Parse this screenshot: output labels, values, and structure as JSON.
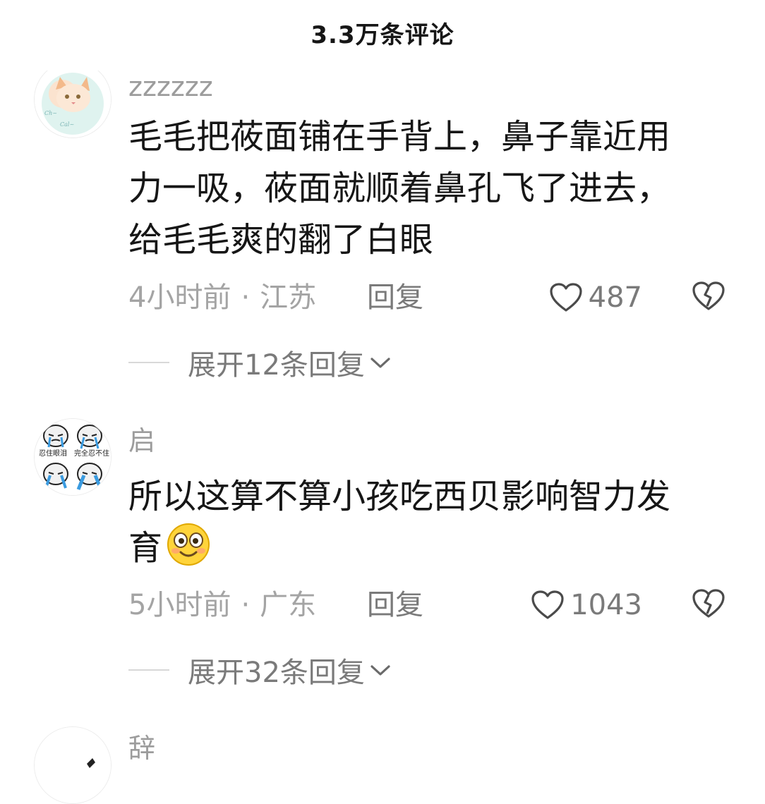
{
  "header": {
    "title": "3.3万条评论"
  },
  "comments": [
    {
      "username": "zzzzzz",
      "lines": [
        "毛毛把莜面铺在手背上，鼻子靠近用",
        "力一吸，莜面就顺着鼻孔飞了进去，",
        "给毛毛爽的翻了白眼"
      ],
      "time": "4小时前",
      "location": "江苏",
      "separator": "·",
      "reply_label": "回复",
      "likes": "487",
      "expand_label": "展开12条回复"
    },
    {
      "username": "启",
      "lines": [
        "所以这算不算小孩吃西贝影响智力发",
        "育"
      ],
      "emoji": "smiling-emoji",
      "time": "5小时前",
      "location": "广东",
      "separator": "·",
      "reply_label": "回复",
      "likes": "1043",
      "expand_label": "展开32条回复"
    },
    {
      "username": "辞"
    }
  ],
  "avatar_texts": [
    "忍住眼泪",
    "完全忍不住"
  ],
  "colors": {
    "text_primary": "#161616",
    "text_secondary": "#a4a4a4",
    "accent_orange": "#f29a3a"
  }
}
